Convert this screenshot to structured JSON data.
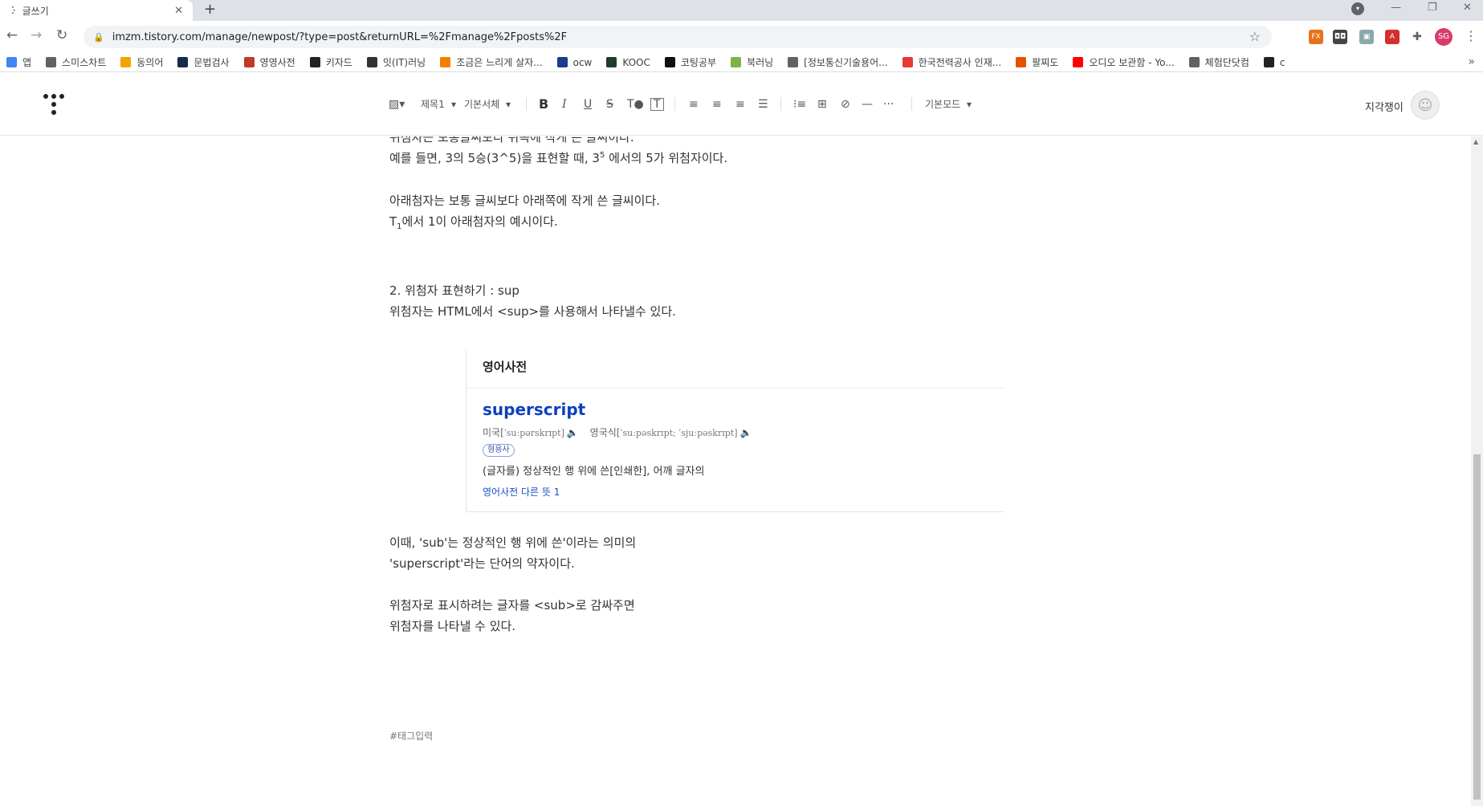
{
  "browser": {
    "tab_title": "글쓰기",
    "url": "imzm.tistory.com/manage/newpost/?type=post&returnURL=%2Fmanage%2Fposts%2F",
    "profile_initials": "SG",
    "bookmarks": [
      {
        "label": "앱",
        "color": "#4285f4"
      },
      {
        "label": "스미스차트",
        "color": "#5f6368"
      },
      {
        "label": "동의어",
        "color": "#f2a600"
      },
      {
        "label": "문법검사",
        "color": "#1a2a4a"
      },
      {
        "label": "영영사전",
        "color": "#c0392b"
      },
      {
        "label": "키자드",
        "color": "#222222"
      },
      {
        "label": "잇(IT)러닝",
        "color": "#333333"
      },
      {
        "label": "조금은 느리게 살자...",
        "color": "#f57d00"
      },
      {
        "label": "ocw",
        "color": "#1a3d8f"
      },
      {
        "label": "KOOC",
        "color": "#1e3d2a"
      },
      {
        "label": "코팅공부",
        "color": "#111111"
      },
      {
        "label": "북러닝",
        "color": "#7cb342"
      },
      {
        "label": "[정보통신기술용어...",
        "color": "#5f6368"
      },
      {
        "label": "한국전력공사 인재...",
        "color": "#e53935"
      },
      {
        "label": "팔찌도",
        "color": "#e65100"
      },
      {
        "label": "오디오 보관함 - Yo...",
        "color": "#ff0000"
      },
      {
        "label": "체험단닷컴",
        "color": "#5f6368"
      },
      {
        "label": "c",
        "color": "#222222"
      }
    ]
  },
  "editor": {
    "toolbar": {
      "heading": "제목1",
      "font": "기본서체",
      "mode": "기본모드"
    },
    "user_name": "지각쟁이"
  },
  "content": {
    "line1": "위첨자는 보통글씨보다 위쪽에 작게 쓴 글씨이다.",
    "line2_pre": "예를 들면, 3의 5승(3^5)을 표현할 때, 3",
    "line2_sup": "5",
    "line2_post": " 에서의 5가 위첨자이다.",
    "line3": "아래첨자는 보통 글씨보다 아래쪽에 작게 쓴 글씨이다.",
    "line4_pre": "T",
    "line4_sub": "1",
    "line4_post": "에서 1이 아래첨자의 예시이다.",
    "line5": "2. 위첨자 표현하기 : sup",
    "line6": "위첨자는 HTML에서 <sup>를 사용해서 나타낼수 있다.",
    "line7": "이때, 'sub'는 정상적인 행 위에 쓴'이라는 의미의",
    "line8": "'superscript'라는 단어의 약자이다.",
    "line9": "위첨자로 표시하려는 글자를 <sub>로 감싸주면",
    "line10": "위첨자를 나타낼 수 있다.",
    "tag_placeholder": "#태그입력"
  },
  "dictionary": {
    "header": "영어사전",
    "word": "superscript",
    "us_label": "미국[",
    "us_ipa": "ˈsuːpərskrɪpt]",
    "uk_label": "영국식[",
    "uk_ipa": "ˈsuːpəskrɪpt; ˈsjuːpəskrɪpt]",
    "pos": "형용사",
    "definition": "(글자를) 정상적인 행 위에 쓴[인쇄한], 어깨 글자의",
    "more_link": "영어사전 다른 뜻 1"
  }
}
